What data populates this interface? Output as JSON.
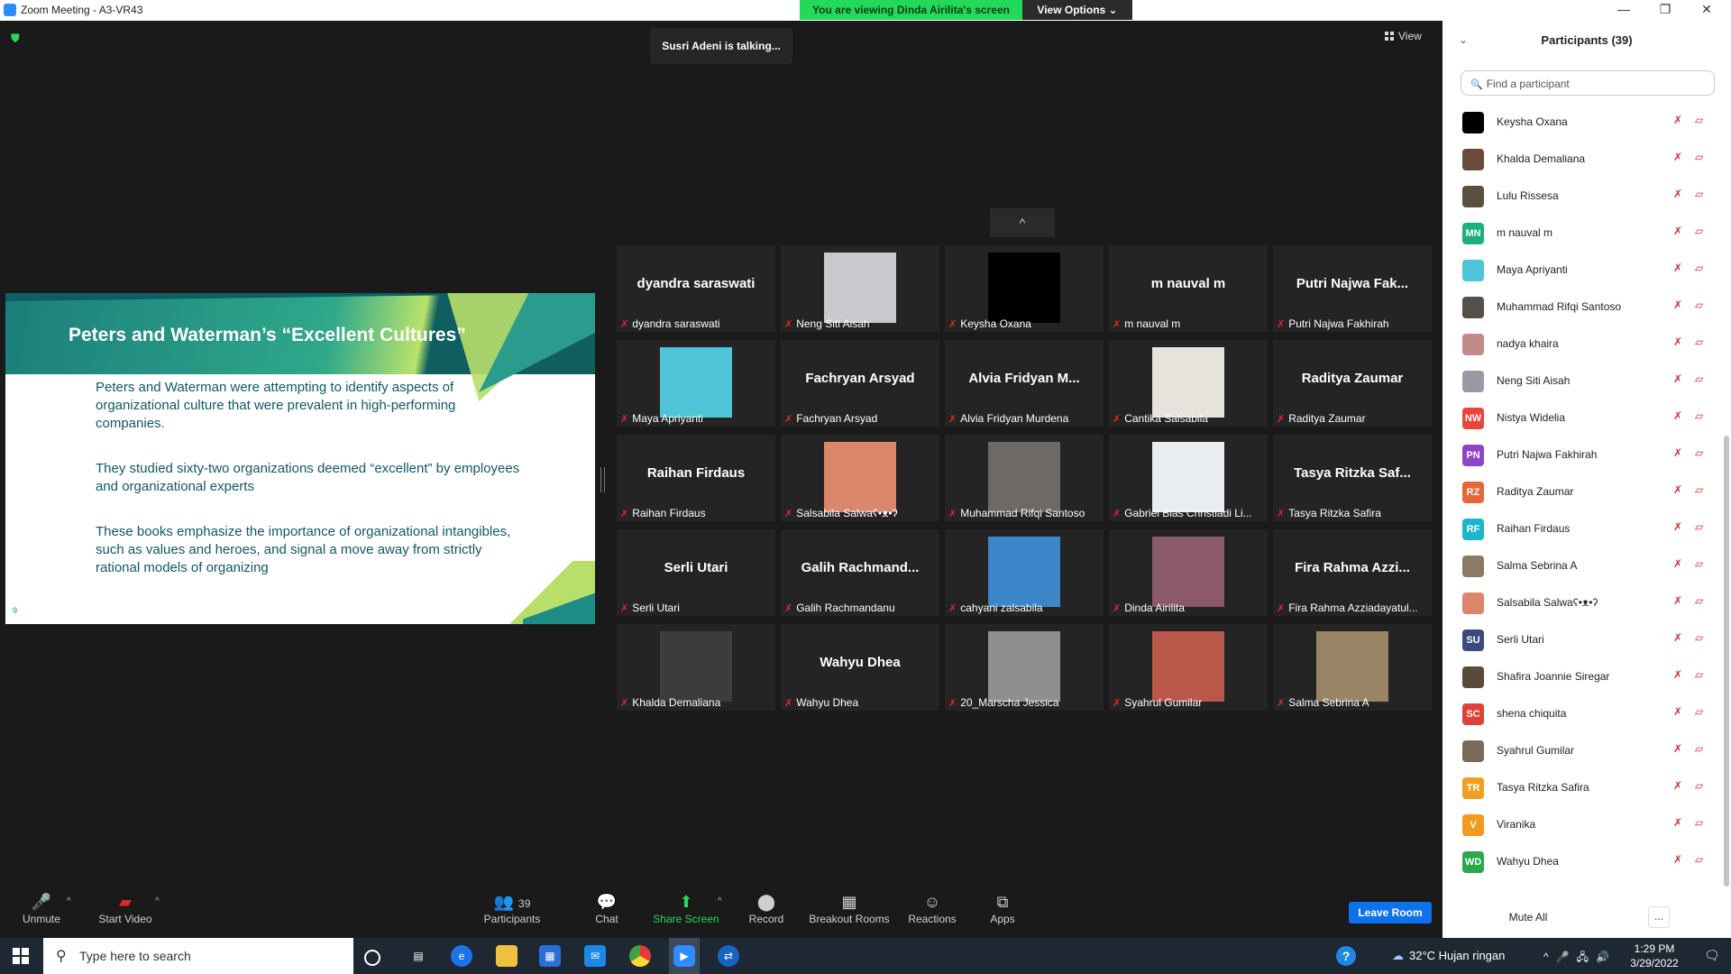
{
  "window": {
    "title": "Zoom Meeting - A3-VR43",
    "viewing_banner": "You are viewing Dinda Airilita's screen",
    "view_options": "View Options ⌄",
    "minimize": "—",
    "maximize": "❐",
    "close": "✕"
  },
  "meeting": {
    "talking": "Susri Adeni is talking...",
    "view_label": "View",
    "gallery_up": "^"
  },
  "slide": {
    "title": "Peters and Waterman’s “Excellent Cultures”",
    "bullets": [
      "Peters and Waterman were attempting to identify aspects of organizational culture that were prevalent in high-performing companies.",
      "They studied sixty-two organizations deemed “excellent” by employees and organizational experts",
      "These books emphasize the importance of organizational intangibles, such as values and heroes, and signal a move away from strictly rational models of organizing"
    ],
    "page_number": "9"
  },
  "gallery": [
    {
      "big": "dyandra saraswati",
      "caption": "dyandra saraswati",
      "photo": ""
    },
    {
      "big": "",
      "caption": "Neng Siti Aisah",
      "photo": "#c9c9cd"
    },
    {
      "big": "",
      "caption": "Keysha Oxana",
      "photo": "#000000"
    },
    {
      "big": "m nauval m",
      "caption": "m nauval m",
      "photo": ""
    },
    {
      "big": "Putri Najwa Fak...",
      "caption": "Putri Najwa Fakhirah",
      "photo": ""
    },
    {
      "big": "",
      "caption": "Maya Apriyanti",
      "photo": "#4fc3d7"
    },
    {
      "big": "Fachryan Arsyad",
      "caption": "Fachryan Arsyad",
      "photo": ""
    },
    {
      "big": "Alvia Fridyan M...",
      "caption": "Alvia Fridyan Murdena",
      "photo": ""
    },
    {
      "big": "",
      "caption": "Cantika Salsabila",
      "photo": "#e6e2dc"
    },
    {
      "big": "Raditya Zaumar",
      "caption": "Raditya Zaumar",
      "photo": ""
    },
    {
      "big": "Raihan Firdaus",
      "caption": "Raihan Firdaus",
      "photo": ""
    },
    {
      "big": "",
      "caption": "Salsabila Salwaʕ•ᴥ•ʔ",
      "photo": "#d9866b"
    },
    {
      "big": "",
      "caption": "Muhammad Rifqi Santoso",
      "photo": "#6d6a66"
    },
    {
      "big": "",
      "caption": "Gabriel Bias Christiadi Li...",
      "photo": "#e9ecf0"
    },
    {
      "big": "Tasya Ritzka Saf...",
      "caption": "Tasya Ritzka Safira",
      "photo": ""
    },
    {
      "big": "Serli Utari",
      "caption": "Serli Utari",
      "photo": ""
    },
    {
      "big": "Galih  Rachmand...",
      "caption": "Galih Rachmandanu",
      "photo": ""
    },
    {
      "big": "",
      "caption": "cahyani zalsabila",
      "photo": "#3a86c8"
    },
    {
      "big": "",
      "caption": "Dinda Airilita",
      "photo": "#8a5a6b"
    },
    {
      "big": "Fira Rahma Azzi...",
      "caption": "Fira Rahma Azziadayatul...",
      "photo": ""
    },
    {
      "big": "",
      "caption": "Khalda Demaliana",
      "photo": "#3c3c3c"
    },
    {
      "big": "Wahyu Dhea",
      "caption": "Wahyu Dhea",
      "photo": ""
    },
    {
      "big": "",
      "caption": "20_Marscha Jessica",
      "photo": "#8f8f8f"
    },
    {
      "big": "",
      "caption": "Syahrul Gumilar",
      "photo": "#b9584a"
    },
    {
      "big": "",
      "caption": "Salma Sebrina A",
      "photo": "#9a8466"
    }
  ],
  "toolbar": {
    "unmute": "Unmute",
    "start_video": "Start Video",
    "participants": "Participants",
    "participants_count": "39",
    "chat": "Chat",
    "share_screen": "Share Screen",
    "record": "Record",
    "breakout_rooms": "Breakout Rooms",
    "reactions": "Reactions",
    "apps": "Apps",
    "leave_room": "Leave Room"
  },
  "panel": {
    "title": "Participants (39)",
    "search_placeholder": "Find a participant",
    "mute_all": "Mute All",
    "more": "...",
    "participants": [
      {
        "name": "Keysha Oxana",
        "initials": "",
        "color": "#000000"
      },
      {
        "name": "Khalda Demaliana",
        "initials": "",
        "color": "#6b4a3a"
      },
      {
        "name": "Lulu Rissesa",
        "initials": "",
        "color": "#5a5040"
      },
      {
        "name": "m nauval m",
        "initials": "MN",
        "color": "#1bb07c"
      },
      {
        "name": "Maya Apriyanti",
        "initials": "",
        "color": "#4fc3d7"
      },
      {
        "name": "Muhammad Rifqi Santoso",
        "initials": "",
        "color": "#55504a"
      },
      {
        "name": "nadya khaira",
        "initials": "",
        "color": "#c48a8a"
      },
      {
        "name": "Neng Siti Aisah",
        "initials": "",
        "color": "#9a9aa4"
      },
      {
        "name": "Nistya Widelia",
        "initials": "NW",
        "color": "#e8453c"
      },
      {
        "name": "Putri Najwa Fakhirah",
        "initials": "PN",
        "color": "#8e44c9"
      },
      {
        "name": "Raditya Zaumar",
        "initials": "RZ",
        "color": "#e8653c"
      },
      {
        "name": "Raihan Firdaus",
        "initials": "RF",
        "color": "#1db5c9"
      },
      {
        "name": "Salma Sebrina A",
        "initials": "",
        "color": "#8a7a66"
      },
      {
        "name": "Salsabila Salwaʕ•ᴥ•ʔ",
        "initials": "",
        "color": "#d9866b"
      },
      {
        "name": "Serli Utari",
        "initials": "SU",
        "color": "#3b4a7a"
      },
      {
        "name": "Shafira Joannie Siregar",
        "initials": "",
        "color": "#5a4a3a"
      },
      {
        "name": "shena chiquita",
        "initials": "SC",
        "color": "#e0403a"
      },
      {
        "name": "Syahrul Gumilar",
        "initials": "",
        "color": "#7a6a5a"
      },
      {
        "name": "Tasya Ritzka Safira",
        "initials": "TR",
        "color": "#f0a020"
      },
      {
        "name": "Viranika",
        "initials": "V",
        "color": "#f09a20"
      },
      {
        "name": "Wahyu Dhea",
        "initials": "WD",
        "color": "#2aaa4a"
      }
    ]
  },
  "taskbar": {
    "search_placeholder": "Type here to search",
    "weather": "32°C  Hujan ringan",
    "time": "1:29 PM",
    "date": "3/29/2022",
    "help": "?"
  }
}
